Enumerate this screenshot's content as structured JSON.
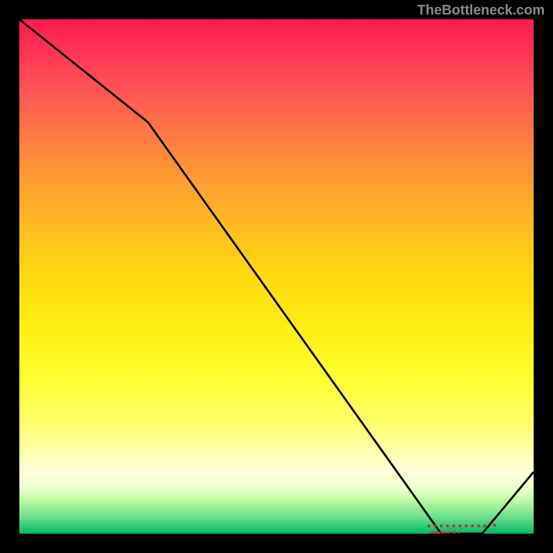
{
  "attribution": "TheBottleneck.com",
  "chart_data": {
    "type": "line",
    "title": "",
    "xlabel": "",
    "ylabel": "",
    "xlim": [
      0,
      100
    ],
    "ylim": [
      0,
      100
    ],
    "x": [
      0,
      25,
      82,
      90,
      100
    ],
    "values": [
      100,
      80,
      0,
      0,
      12
    ],
    "marker": {
      "x": 85,
      "y": 1.5,
      "label": "••••••••• •• •"
    },
    "background": "rainbow-gradient-vertical",
    "description": "Bottleneck curve descending from top-left to a minimum near x=82-90, then rising; rendered over a vertical red-to-green gradient heatmap."
  }
}
